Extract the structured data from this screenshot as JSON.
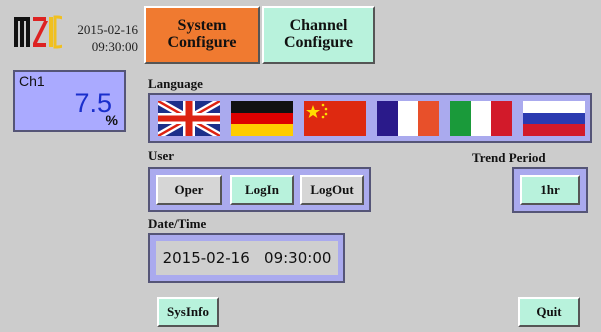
{
  "header": {
    "date": "2015-02-16",
    "time": "09:30:00",
    "logo_text": "MZID"
  },
  "channel": {
    "name": "Ch1",
    "value": "7.5",
    "unit": "%"
  },
  "tabs": {
    "system_line1": "System",
    "system_line2": "Configure",
    "channel_line1": "Channel",
    "channel_line2": "Configure"
  },
  "language": {
    "label": "Language",
    "flags": [
      "united-kingdom",
      "germany",
      "china",
      "france",
      "italy",
      "russia"
    ]
  },
  "user": {
    "label": "User",
    "oper": "Oper",
    "login": "LogIn",
    "logout": "LogOut"
  },
  "trend": {
    "label": "Trend Period",
    "value": "1hr"
  },
  "datetime": {
    "label": "Date/Time",
    "value": "2015-02-16   09:30:00"
  },
  "footer": {
    "sysinfo": "SysInfo",
    "quit": "Quit"
  },
  "colors": {
    "background": "#cccccc",
    "system_tab": "#f07a30",
    "green_button": "#b8f2dc",
    "panel": "#aaaaee",
    "value_blue": "#1a2fcc"
  }
}
